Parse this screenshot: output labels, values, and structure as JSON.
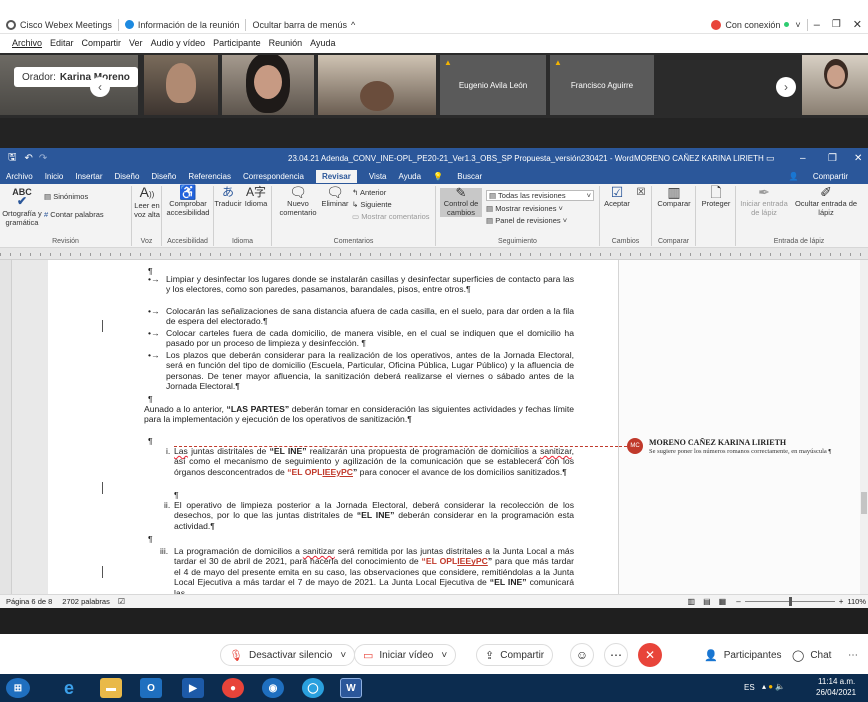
{
  "webex": {
    "app_title": "Cisco Webex Meetings",
    "meeting_info": "Información de la reunión",
    "hide_menu": "Ocultar barra de menús",
    "connection": "Con conexión",
    "menu": [
      "Archivo",
      "Editar",
      "Compartir",
      "Ver",
      "Audio y vídeo",
      "Participante",
      "Reunión",
      "Ayuda"
    ],
    "speaker_label": "Orador:",
    "speaker_name": "Karina Moreno",
    "participants": [
      "Eugenio Avila León",
      "Francisco Aguirre"
    ]
  },
  "word": {
    "doc_title": "23.04.21 Adenda_CONV_INE-OPL_PE20-21_Ver1.3_OBS_SP Propuesta_versión230421  -  Word",
    "user": "MORENO CAÑEZ KARINA LIRIETH",
    "tabs": [
      "Archivo",
      "Inicio",
      "Insertar",
      "Diseño",
      "Diseño",
      "Referencias",
      "Correspondencia",
      "Revisar",
      "Vista",
      "Ayuda",
      "Buscar"
    ],
    "share": "Compartir",
    "ribbon": {
      "revision": {
        "label": "Revisión",
        "spelling": "Ortografía y gramática",
        "thesaurus": "Sinónimos",
        "word_count": "Contar palabras"
      },
      "voice": {
        "label": "Voz",
        "read_aloud": "Leer en voz alta"
      },
      "accessibility": {
        "label": "Accesibilidad",
        "check": "Comprobar accesibilidad"
      },
      "language": {
        "label": "Idioma",
        "translate": "Traducir",
        "lang": "Idioma"
      },
      "comments": {
        "label": "Comentarios",
        "new": "Nuevo comentario",
        "delete": "Eliminar",
        "previous": "Anterior",
        "next": "Siguiente",
        "show": "Mostrar comentarios"
      },
      "tracking": {
        "label": "Seguimiento",
        "control": "Control de cambios",
        "all_markup": "Todas las revisiones",
        "show_markup": "Mostrar revisiones",
        "pane": "Panel de revisiones"
      },
      "changes": {
        "label": "Cambios",
        "accept": "Aceptar"
      },
      "compare": {
        "label": "Comparar",
        "compare": "Comparar"
      },
      "protect": {
        "label": "",
        "protect": "Proteger"
      },
      "ink": {
        "label": "Entrada de lápiz",
        "start": "Iniciar entrada de lápiz",
        "hide": "Ocultar entrada de lápiz"
      }
    },
    "status": {
      "page": "Página 6 de 8",
      "words": "2702 palabras",
      "zoom": "110%"
    }
  },
  "document": {
    "pilcrow": "¶",
    "bullets": [
      "Limpiar y desinfectar los lugares donde se instalarán casillas y desinfectar superficies de contacto para las y los electores, como son paredes, pasamanos, barandales, pisos, entre otros.¶",
      "Colocarán las señalizaciones de sana distancia afuera de cada casilla, en el suelo, para dar orden a la fila de espera del electorado.¶",
      "Colocar carteles fuera de cada domicilio, de manera visible, en el cual se indiquen que el domicilio ha pasado por un proceso de limpieza y desinfección. ¶",
      "Los plazos que deberán considerar para la realización de los operativos, antes de la Jornada Electoral, será en función del tipo de domicilio (Escuela, Particular, Oficina Pública, Lugar Público) y la afluencia de personas. De tener mayor afluencia, la sanitización deberá realizarse el viernes o sábado antes de la Jornada Electoral.¶"
    ],
    "intro_a": "Aunado a lo anterior, ",
    "intro_b": "“LAS PARTES”",
    "intro_c": " deberán tomar en consideración las siguientes actividades y fechas límite para la implementación y ejecución de los operativos de sanitización.¶",
    "item_i": {
      "num": "i.",
      "t1": "Las",
      "t2": " juntas distritales de ",
      "t3": "“EL INE”",
      "t4": " realizarán una propuesta de programación de domicilios a ",
      "t5": "sanitizar",
      "t6": ", así como el mecanismo de seguimiento y agilización de la comunicación que se establecerá con los órganos desconcentrados de ",
      "t7": "“EL OPL",
      "t8": "IEEyPC",
      "t9": "”",
      "t10": " para conocer el avance de los domicilios sanitizados.¶"
    },
    "item_ii": {
      "num": "ii.",
      "t1": "El operativo de limpieza posterior a la Jornada Electoral, deberá considerar la recolección de los desechos, por lo que las juntas distritales de ",
      "t2": "“EL INE”",
      "t3": " deberán considerar en la programación esta actividad.¶"
    },
    "item_iii": {
      "num": "iii.",
      "t1": "La programación de domicilios a ",
      "t2": "sanitizar",
      "t3": " será remitida por las juntas distritales a la Junta Local a más tardar el 30 de abril de 2021, para hacerla del conocimiento de ",
      "t4": "“EL OPL",
      "t5": "IEEyPC",
      "t6": "”",
      "t7": " para que más tardar el 4 de mayo del presente emita en su caso, las observaciones que considere, remitiéndolas a la Junta Local Ejecutiva a más tardar el 7 de mayo de 2021. La Junta Local Ejecutiva de ",
      "t8": "“EL INE”",
      "t9": " comunicará las"
    }
  },
  "comment": {
    "initials": "MC",
    "author": "MORENO CAÑEZ KARINA LIRIETH",
    "text": "Se sugiere poner los números romanos correctamente, en mayúscula ¶"
  },
  "controls": {
    "mute": "Desactivar silencio",
    "video": "Iniciar vídeo",
    "share": "Compartir",
    "participants": "Participantes",
    "chat": "Chat"
  },
  "taskbar": {
    "lang": "ES",
    "time": "11:14 a.m.",
    "date": "26/04/2021"
  },
  "colors": {
    "word_blue": "#2b579a",
    "webex_red": "#e8443a",
    "connected_green": "#2ecc71"
  }
}
